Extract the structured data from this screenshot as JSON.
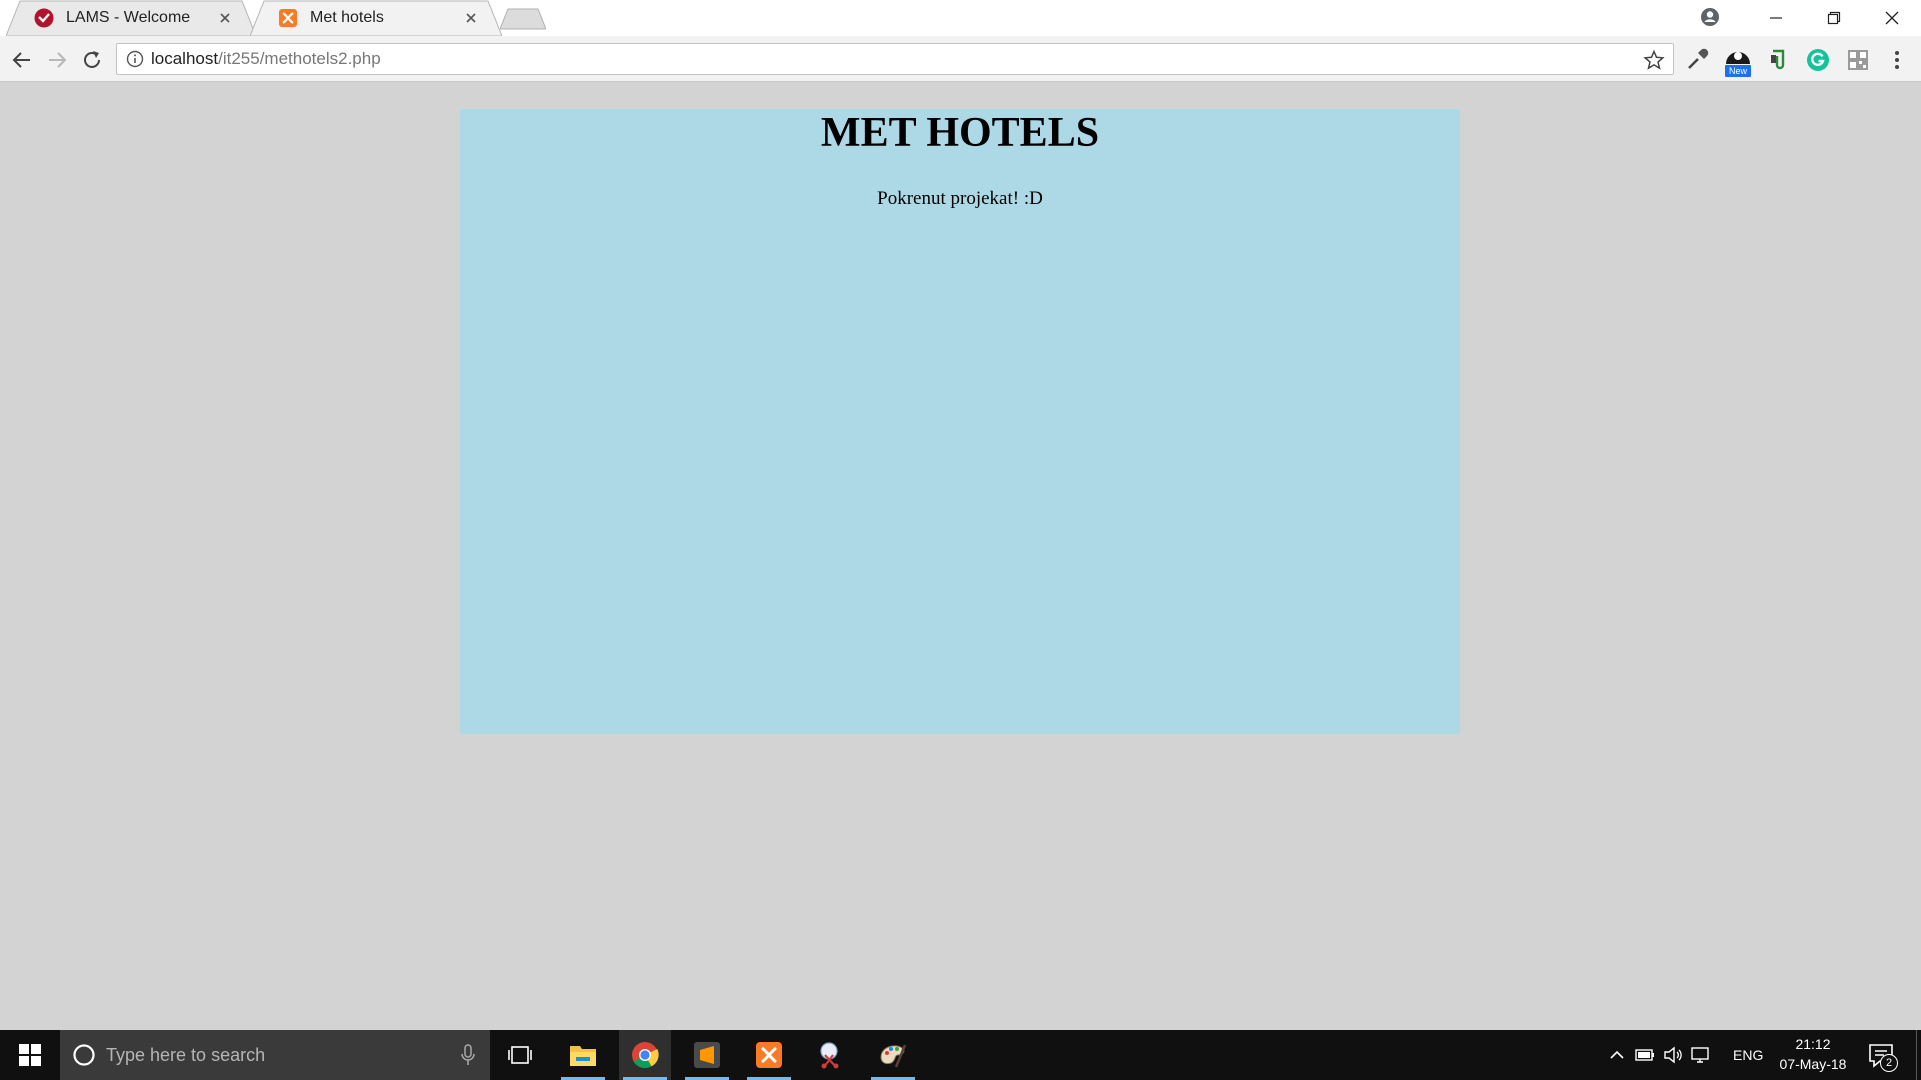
{
  "browser": {
    "tabs": [
      {
        "title": "LAMS - Welcome",
        "favicon": "lams-check-icon",
        "active": false
      },
      {
        "title": "Met hotels",
        "favicon": "xampp-icon",
        "active": true
      }
    ],
    "url_host": "localhost",
    "url_path": "/it255/methotels2.php",
    "extensions": [
      "eyedropper-icon",
      "new-badge-extension-icon",
      "evernote-clip-icon",
      "grammarly-icon",
      "qr-code-icon"
    ],
    "new_badge": "New"
  },
  "page": {
    "heading": "MET HOTELS",
    "message": "Pokrenut projekat! :D",
    "colors": {
      "background": "#d3d3d3",
      "panel": "#add8e6"
    }
  },
  "taskbar": {
    "search_placeholder": "Type here to search",
    "apps": [
      "file-explorer-icon",
      "chrome-icon",
      "sublime-text-icon",
      "xampp-icon",
      "snipping-tool-icon",
      "paint-icon"
    ],
    "language": "ENG",
    "time": "21:12",
    "date": "07-May-18",
    "notification_count": "2"
  }
}
